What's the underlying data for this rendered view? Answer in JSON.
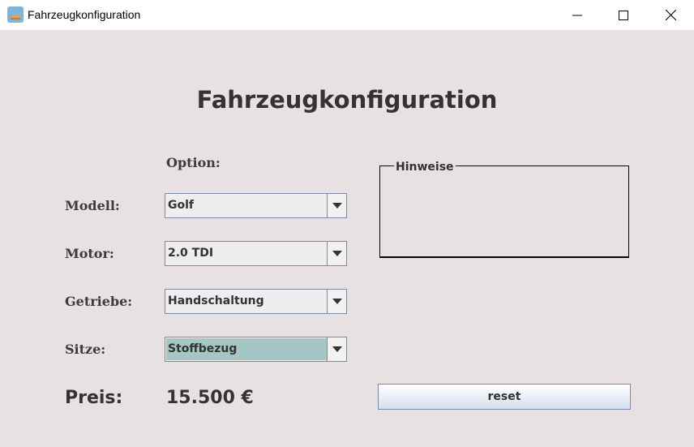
{
  "window": {
    "title": "Fahrzeugkonfiguration",
    "controls": [
      "minimize-icon",
      "maximize-icon",
      "close-icon"
    ]
  },
  "main": {
    "heading": "Fahrzeugkonfiguration",
    "option_header": "Option:",
    "rows": [
      {
        "label": "Modell:",
        "value": "Golf"
      },
      {
        "label": "Motor:",
        "value": "2.0 TDI"
      },
      {
        "label": "Getriebe:",
        "value": "Handschaltung"
      },
      {
        "label": "Sitze:",
        "value": "Stoffbezug"
      }
    ],
    "hinweise": {
      "title": "Hinweise"
    },
    "price": {
      "label": "Preis:",
      "value": "15.500 €"
    },
    "reset_label": "reset"
  },
  "colors": {
    "background": "#e8e1e1",
    "selected_field": "#a5c6c4",
    "combo_border": "#7a8aa6"
  }
}
